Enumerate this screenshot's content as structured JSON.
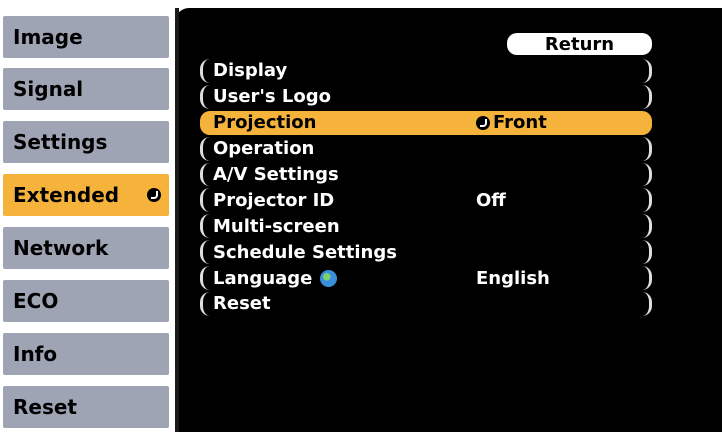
{
  "tabs": [
    {
      "label": "Image"
    },
    {
      "label": "Signal"
    },
    {
      "label": "Settings"
    },
    {
      "label": "Extended"
    },
    {
      "label": "Network"
    },
    {
      "label": "ECO"
    },
    {
      "label": "Info"
    },
    {
      "label": "Reset"
    }
  ],
  "active_tab": "Extended",
  "return_label": "Return",
  "menu": [
    {
      "label": "Display",
      "value": ""
    },
    {
      "label": "User's Logo",
      "value": ""
    },
    {
      "label": "Projection",
      "value": "Front"
    },
    {
      "label": "Operation",
      "value": ""
    },
    {
      "label": "A/V Settings",
      "value": ""
    },
    {
      "label": "Projector ID",
      "value": "Off"
    },
    {
      "label": "Multi-screen",
      "value": ""
    },
    {
      "label": "Schedule Settings",
      "value": ""
    },
    {
      "label": "Language",
      "value": "English",
      "icon": "globe-icon"
    },
    {
      "label": "Reset",
      "value": ""
    }
  ],
  "selected_item": "Projection",
  "colors": {
    "accent": "#f6b33c",
    "tab": "#9ea4b4",
    "panel": "#000000"
  }
}
